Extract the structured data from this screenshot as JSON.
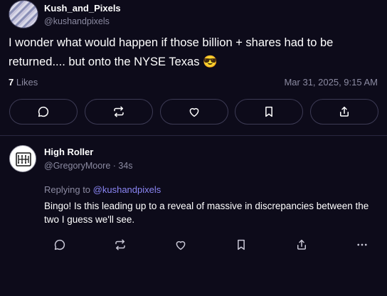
{
  "post": {
    "author_name": "Kush_and_Pixels",
    "author_handle": "@kushandpixels",
    "text": "I  wonder what would happen if those billion + shares had to be returned.... but onto the NYSE Texas 😎",
    "likes_count": "7",
    "likes_label": "Likes",
    "timestamp": "Mar 31, 2025, 9:15 AM",
    "actions": [
      "reply-icon",
      "repost-icon",
      "like-icon",
      "bookmark-icon",
      "share-icon"
    ]
  },
  "reply": {
    "author_name": "High Roller",
    "meta": "@GregoryMoore · 34s",
    "replying_prefix": "Replying to",
    "replying_handle": "@kushandpixels",
    "text": "Bingo! Is this leading up to a reveal of massive in discrepancies between the two I guess we'll see.",
    "actions": [
      "reply-icon",
      "repost-icon",
      "like-icon",
      "bookmark-icon",
      "share-icon",
      "more-icon"
    ]
  },
  "colors": {
    "background": "#0d0b1a",
    "muted_text": "#8b8aa1",
    "mention": "#8b86f5",
    "border": "#3d3b55"
  }
}
